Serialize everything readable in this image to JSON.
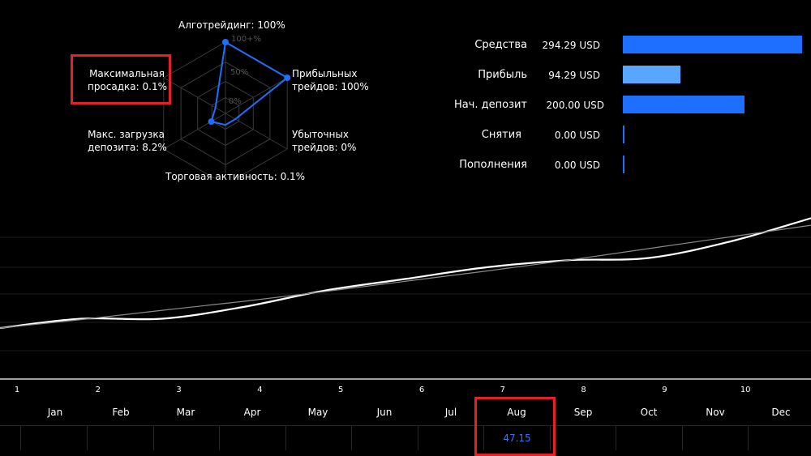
{
  "radar": {
    "scale_labels": [
      "100+%",
      "50%",
      "0%"
    ],
    "axes": [
      {
        "label": "Алготрейдинг: 100%",
        "value": 100
      },
      {
        "label": "Прибыльных\nтрейдов: 100%",
        "value": 100
      },
      {
        "label": "Убыточных\nтрейдов: 0%",
        "value": 0
      },
      {
        "label": "Торговая активность: 0.1%",
        "value": 0.1
      },
      {
        "label": "Макс. загрузка\nдепозита: 8.2%",
        "value": 8.2
      },
      {
        "label": "Максимальная\nпросадка: 0.1%",
        "value": 0.1
      }
    ],
    "color": "#1e6fff"
  },
  "balance_bars": [
    {
      "label": "Средства",
      "value": 294.29,
      "display": "294.29 USD",
      "color": "#1e6fff"
    },
    {
      "label": "Прибыль",
      "value": 94.29,
      "display": "94.29 USD",
      "color": "#58a6ff"
    },
    {
      "label": "Нач. депозит",
      "value": 200.0,
      "display": "200.00 USD",
      "color": "#1e6fff"
    },
    {
      "label": "Снятия",
      "value": 0.0,
      "display": "0.00 USD",
      "color": "#1e6fff"
    },
    {
      "label": "Пополнения",
      "value": 0.0,
      "display": "0.00 USD",
      "color": "#1e6fff"
    }
  ],
  "chart_data": {
    "type": "line",
    "x_ticks": [
      "1",
      "2",
      "3",
      "4",
      "5",
      "6",
      "7",
      "8",
      "9",
      "10"
    ],
    "months": [
      "Jan",
      "Feb",
      "Mar",
      "Apr",
      "May",
      "Jun",
      "Jul",
      "Aug",
      "Sep",
      "Oct",
      "Nov",
      "Dec"
    ],
    "month_values": {
      "Aug": "47.15"
    },
    "series": [
      {
        "values": [
          0.0,
          0.2,
          0.2,
          0.45,
          0.8,
          1.05,
          1.3,
          1.45,
          1.5,
          1.85,
          2.35
        ]
      },
      {
        "values": [
          0.0,
          0.18,
          0.38,
          0.57,
          0.78,
          1.0,
          1.22,
          1.45,
          1.7,
          1.95,
          2.2
        ]
      }
    ],
    "line_colors": [
      "#ffffff",
      "#8a8a8a"
    ]
  },
  "highlight_color": "#e5202b"
}
